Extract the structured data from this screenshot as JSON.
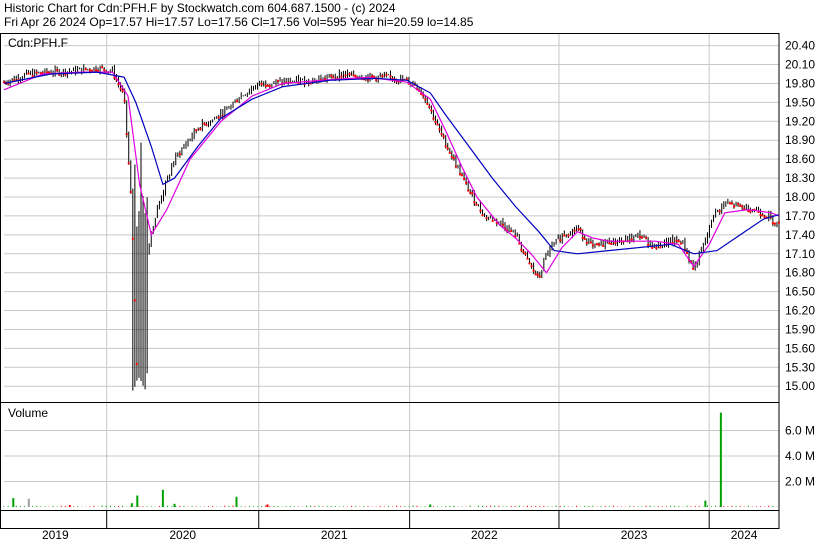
{
  "header": {
    "line1": "Historic Chart for Cdn:PFH.F by Stockwatch.com 604.687.1500 - (c) 2024",
    "line2": "Fri Apr 26 2024   Op=17.57  Hi=17.57  Lo=17.56  Cl=17.56  Vol=595  Year hi=20.59  lo=14.85"
  },
  "colors": {
    "price_bar": "#000000",
    "down_dot": "#ff0000",
    "ma_short": "#e000e0",
    "ma_long": "#0000c0",
    "volume_up": "#00a000",
    "volume_down": "#ff0000",
    "volume_flat": "#a0a0a0",
    "grid": "#c8c8c8"
  },
  "chart_data": [
    {
      "type": "line",
      "label": "Cdn:PFH.F",
      "ylim": [
        14.75,
        20.6
      ],
      "yticks": [
        "20.40",
        "20.10",
        "19.80",
        "19.50",
        "19.20",
        "18.90",
        "18.60",
        "18.30",
        "18.00",
        "17.70",
        "17.40",
        "17.10",
        "16.80",
        "16.50",
        "16.20",
        "15.90",
        "15.60",
        "15.30",
        "15.00"
      ],
      "xticks": [
        "2019",
        "2020",
        "2021",
        "2022",
        "2023",
        "2024"
      ],
      "year_boundaries_t": [
        0.1325,
        0.3287,
        0.5234,
        0.7161,
        0.9099
      ],
      "series": [
        {
          "role": "close",
          "points": [
            [
              0.0,
              19.82
            ],
            [
              0.03,
              19.95
            ],
            [
              0.06,
              19.98
            ],
            [
              0.09,
              20.0
            ],
            [
              0.12,
              20.05
            ],
            [
              0.14,
              20.0
            ],
            [
              0.155,
              19.6
            ],
            [
              0.165,
              17.8
            ],
            [
              0.172,
              15.2
            ],
            [
              0.178,
              15.6
            ],
            [
              0.185,
              17.2
            ],
            [
              0.2,
              17.9
            ],
            [
              0.22,
              18.6
            ],
            [
              0.25,
              19.1
            ],
            [
              0.28,
              19.3
            ],
            [
              0.3,
              19.55
            ],
            [
              0.33,
              19.8
            ],
            [
              0.36,
              19.82
            ],
            [
              0.4,
              19.85
            ],
            [
              0.44,
              19.95
            ],
            [
              0.47,
              19.9
            ],
            [
              0.5,
              19.9
            ],
            [
              0.53,
              19.8
            ],
            [
              0.545,
              19.55
            ],
            [
              0.56,
              19.1
            ],
            [
              0.58,
              18.6
            ],
            [
              0.6,
              18.1
            ],
            [
              0.62,
              17.7
            ],
            [
              0.64,
              17.6
            ],
            [
              0.66,
              17.4
            ],
            [
              0.675,
              17.0
            ],
            [
              0.69,
              16.7
            ],
            [
              0.7,
              17.1
            ],
            [
              0.72,
              17.4
            ],
            [
              0.74,
              17.5
            ],
            [
              0.76,
              17.2
            ],
            [
              0.78,
              17.3
            ],
            [
              0.8,
              17.3
            ],
            [
              0.82,
              17.4
            ],
            [
              0.84,
              17.2
            ],
            [
              0.86,
              17.3
            ],
            [
              0.875,
              17.3
            ],
            [
              0.89,
              16.85
            ],
            [
              0.905,
              17.3
            ],
            [
              0.915,
              17.7
            ],
            [
              0.93,
              17.9
            ],
            [
              0.95,
              17.85
            ],
            [
              0.97,
              17.8
            ],
            [
              0.985,
              17.7
            ],
            [
              1.0,
              17.56
            ]
          ]
        },
        {
          "role": "ma_short",
          "points": [
            [
              0.0,
              19.7
            ],
            [
              0.05,
              19.95
            ],
            [
              0.1,
              19.98
            ],
            [
              0.14,
              19.98
            ],
            [
              0.16,
              19.6
            ],
            [
              0.175,
              18.2
            ],
            [
              0.19,
              17.4
            ],
            [
              0.21,
              17.8
            ],
            [
              0.24,
              18.6
            ],
            [
              0.28,
              19.2
            ],
            [
              0.32,
              19.6
            ],
            [
              0.36,
              19.8
            ],
            [
              0.42,
              19.86
            ],
            [
              0.47,
              19.9
            ],
            [
              0.52,
              19.82
            ],
            [
              0.55,
              19.55
            ],
            [
              0.57,
              19.05
            ],
            [
              0.59,
              18.5
            ],
            [
              0.61,
              18.0
            ],
            [
              0.64,
              17.55
            ],
            [
              0.66,
              17.35
            ],
            [
              0.68,
              17.1
            ],
            [
              0.7,
              16.8
            ],
            [
              0.72,
              17.2
            ],
            [
              0.74,
              17.45
            ],
            [
              0.76,
              17.35
            ],
            [
              0.78,
              17.3
            ],
            [
              0.81,
              17.3
            ],
            [
              0.84,
              17.3
            ],
            [
              0.87,
              17.25
            ],
            [
              0.89,
              16.9
            ],
            [
              0.91,
              17.25
            ],
            [
              0.93,
              17.75
            ],
            [
              0.96,
              17.8
            ],
            [
              0.99,
              17.75
            ],
            [
              1.0,
              17.7
            ]
          ]
        },
        {
          "role": "ma_long",
          "points": [
            [
              0.0,
              19.8
            ],
            [
              0.06,
              19.95
            ],
            [
              0.12,
              19.98
            ],
            [
              0.155,
              19.9
            ],
            [
              0.17,
              19.5
            ],
            [
              0.19,
              18.8
            ],
            [
              0.205,
              18.2
            ],
            [
              0.22,
              18.3
            ],
            [
              0.25,
              18.8
            ],
            [
              0.28,
              19.25
            ],
            [
              0.32,
              19.55
            ],
            [
              0.36,
              19.75
            ],
            [
              0.42,
              19.85
            ],
            [
              0.48,
              19.88
            ],
            [
              0.52,
              19.85
            ],
            [
              0.55,
              19.65
            ],
            [
              0.57,
              19.3
            ],
            [
              0.6,
              18.8
            ],
            [
              0.63,
              18.3
            ],
            [
              0.66,
              17.85
            ],
            [
              0.69,
              17.45
            ],
            [
              0.71,
              17.15
            ],
            [
              0.74,
              17.1
            ],
            [
              0.78,
              17.15
            ],
            [
              0.82,
              17.2
            ],
            [
              0.86,
              17.25
            ],
            [
              0.89,
              17.1
            ],
            [
              0.92,
              17.15
            ],
            [
              0.95,
              17.4
            ],
            [
              0.98,
              17.65
            ],
            [
              1.0,
              17.72
            ]
          ]
        }
      ]
    },
    {
      "type": "bar",
      "label": "Volume",
      "ylim": [
        0,
        8000000
      ],
      "yticks": [
        "6.0 M",
        "4.0 M",
        "2.0 M"
      ],
      "yticks_values": [
        6000000,
        4000000,
        2000000
      ],
      "spikes": [
        {
          "t": 0.012,
          "v": 700000,
          "c": "volume_up"
        },
        {
          "t": 0.032,
          "v": 650000,
          "c": "volume_flat"
        },
        {
          "t": 0.085,
          "v": 150000,
          "c": "volume_down"
        },
        {
          "t": 0.165,
          "v": 300000,
          "c": "volume_up"
        },
        {
          "t": 0.172,
          "v": 900000,
          "c": "volume_up"
        },
        {
          "t": 0.205,
          "v": 1350000,
          "c": "volume_up"
        },
        {
          "t": 0.22,
          "v": 250000,
          "c": "volume_up"
        },
        {
          "t": 0.3,
          "v": 800000,
          "c": "volume_up"
        },
        {
          "t": 0.34,
          "v": 200000,
          "c": "volume_down"
        },
        {
          "t": 0.55,
          "v": 200000,
          "c": "volume_up"
        },
        {
          "t": 0.905,
          "v": 500000,
          "c": "volume_up"
        },
        {
          "t": 0.925,
          "v": 7400000,
          "c": "volume_up"
        }
      ]
    }
  ]
}
